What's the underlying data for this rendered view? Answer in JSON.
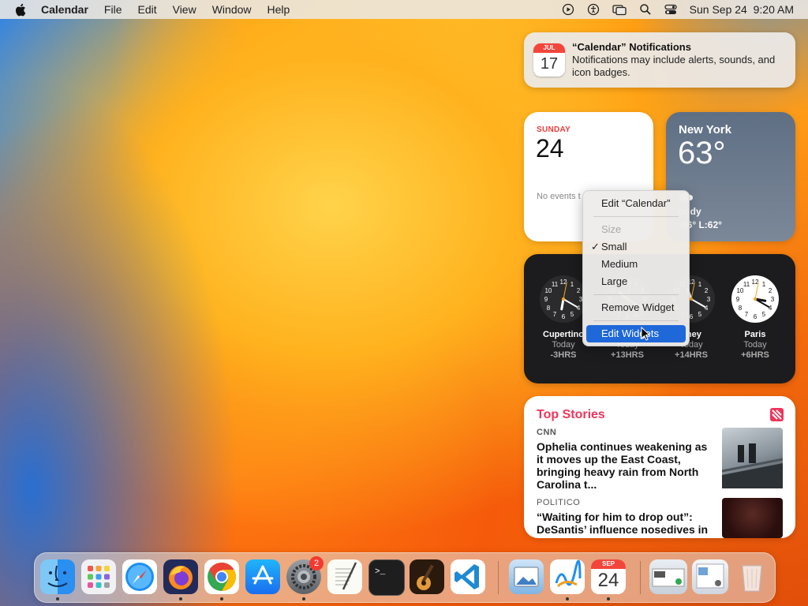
{
  "menubar": {
    "app_name": "Calendar",
    "items": [
      "File",
      "Edit",
      "View",
      "Window",
      "Help"
    ],
    "datetime": "Sun Sep 24  9:20 AM",
    "icons": [
      "apple-logo-icon",
      "play-icon",
      "accessibility-icon",
      "screen-mirroring-icon",
      "search-icon",
      "control-center-icon"
    ]
  },
  "notification": {
    "icon_month": "JUL",
    "icon_day": "17",
    "title": "“Calendar” Notifications",
    "body": "Notifications may include alerts, sounds, and icon badges."
  },
  "calendar_widget": {
    "day_name": "SUNDAY",
    "day_number": "24",
    "no_events": "No events t"
  },
  "weather_widget": {
    "city": "New York",
    "temperature": "63°",
    "condition": "oudy",
    "hilo": ":66° L:62°"
  },
  "clock_widget": {
    "clocks": [
      {
        "name": "Cupertino",
        "day": "Today",
        "offset": "-3HRS",
        "hour": 6,
        "minute": 20,
        "dark": true
      },
      {
        "name": "",
        "day": "Today",
        "offset": "+13HRS",
        "hour": 10,
        "minute": 20,
        "dark": true
      },
      {
        "name": "dney",
        "day": "Today",
        "offset": "+14HRS",
        "hour": 11,
        "minute": 20,
        "dark": true
      },
      {
        "name": "Paris",
        "day": "Today",
        "offset": "+6HRS",
        "hour": 3,
        "minute": 20,
        "dark": false
      }
    ]
  },
  "news_widget": {
    "title": "Top Stories",
    "stories": [
      {
        "source": "CNN",
        "headline": "Ophelia continues weakening as it moves up the East Coast, bringing heavy rain from North Carolina t..."
      },
      {
        "source": "POLITICO",
        "headline": "“Waiting for him to drop out”: DeSantis’ influence nosedives in"
      }
    ]
  },
  "context_menu": {
    "edit_calendar": "Edit “Calendar”",
    "size_header": "Size",
    "small": "Small",
    "small_check": "✓",
    "medium": "Medium",
    "large": "Large",
    "remove_widget": "Remove Widget",
    "edit_widgets": "Edit Widgets"
  },
  "dock": {
    "apps": [
      "Finder",
      "Launchpad",
      "Safari",
      "Firefox",
      "Google Chrome",
      "App Store",
      "System Settings",
      "TextEdit",
      "Terminal",
      "GarageBand",
      "Visual Studio Code",
      "Preview",
      "Freeform",
      "Calendar",
      "Recent Windows",
      "Downloads",
      "Trash"
    ],
    "settings_badge": "2",
    "calendar_month": "SEP",
    "calendar_day": "24"
  },
  "colors": {
    "accent": "#1f68d9",
    "calendar_red": "#ef3b3b",
    "news_pink": "#f0345a"
  }
}
